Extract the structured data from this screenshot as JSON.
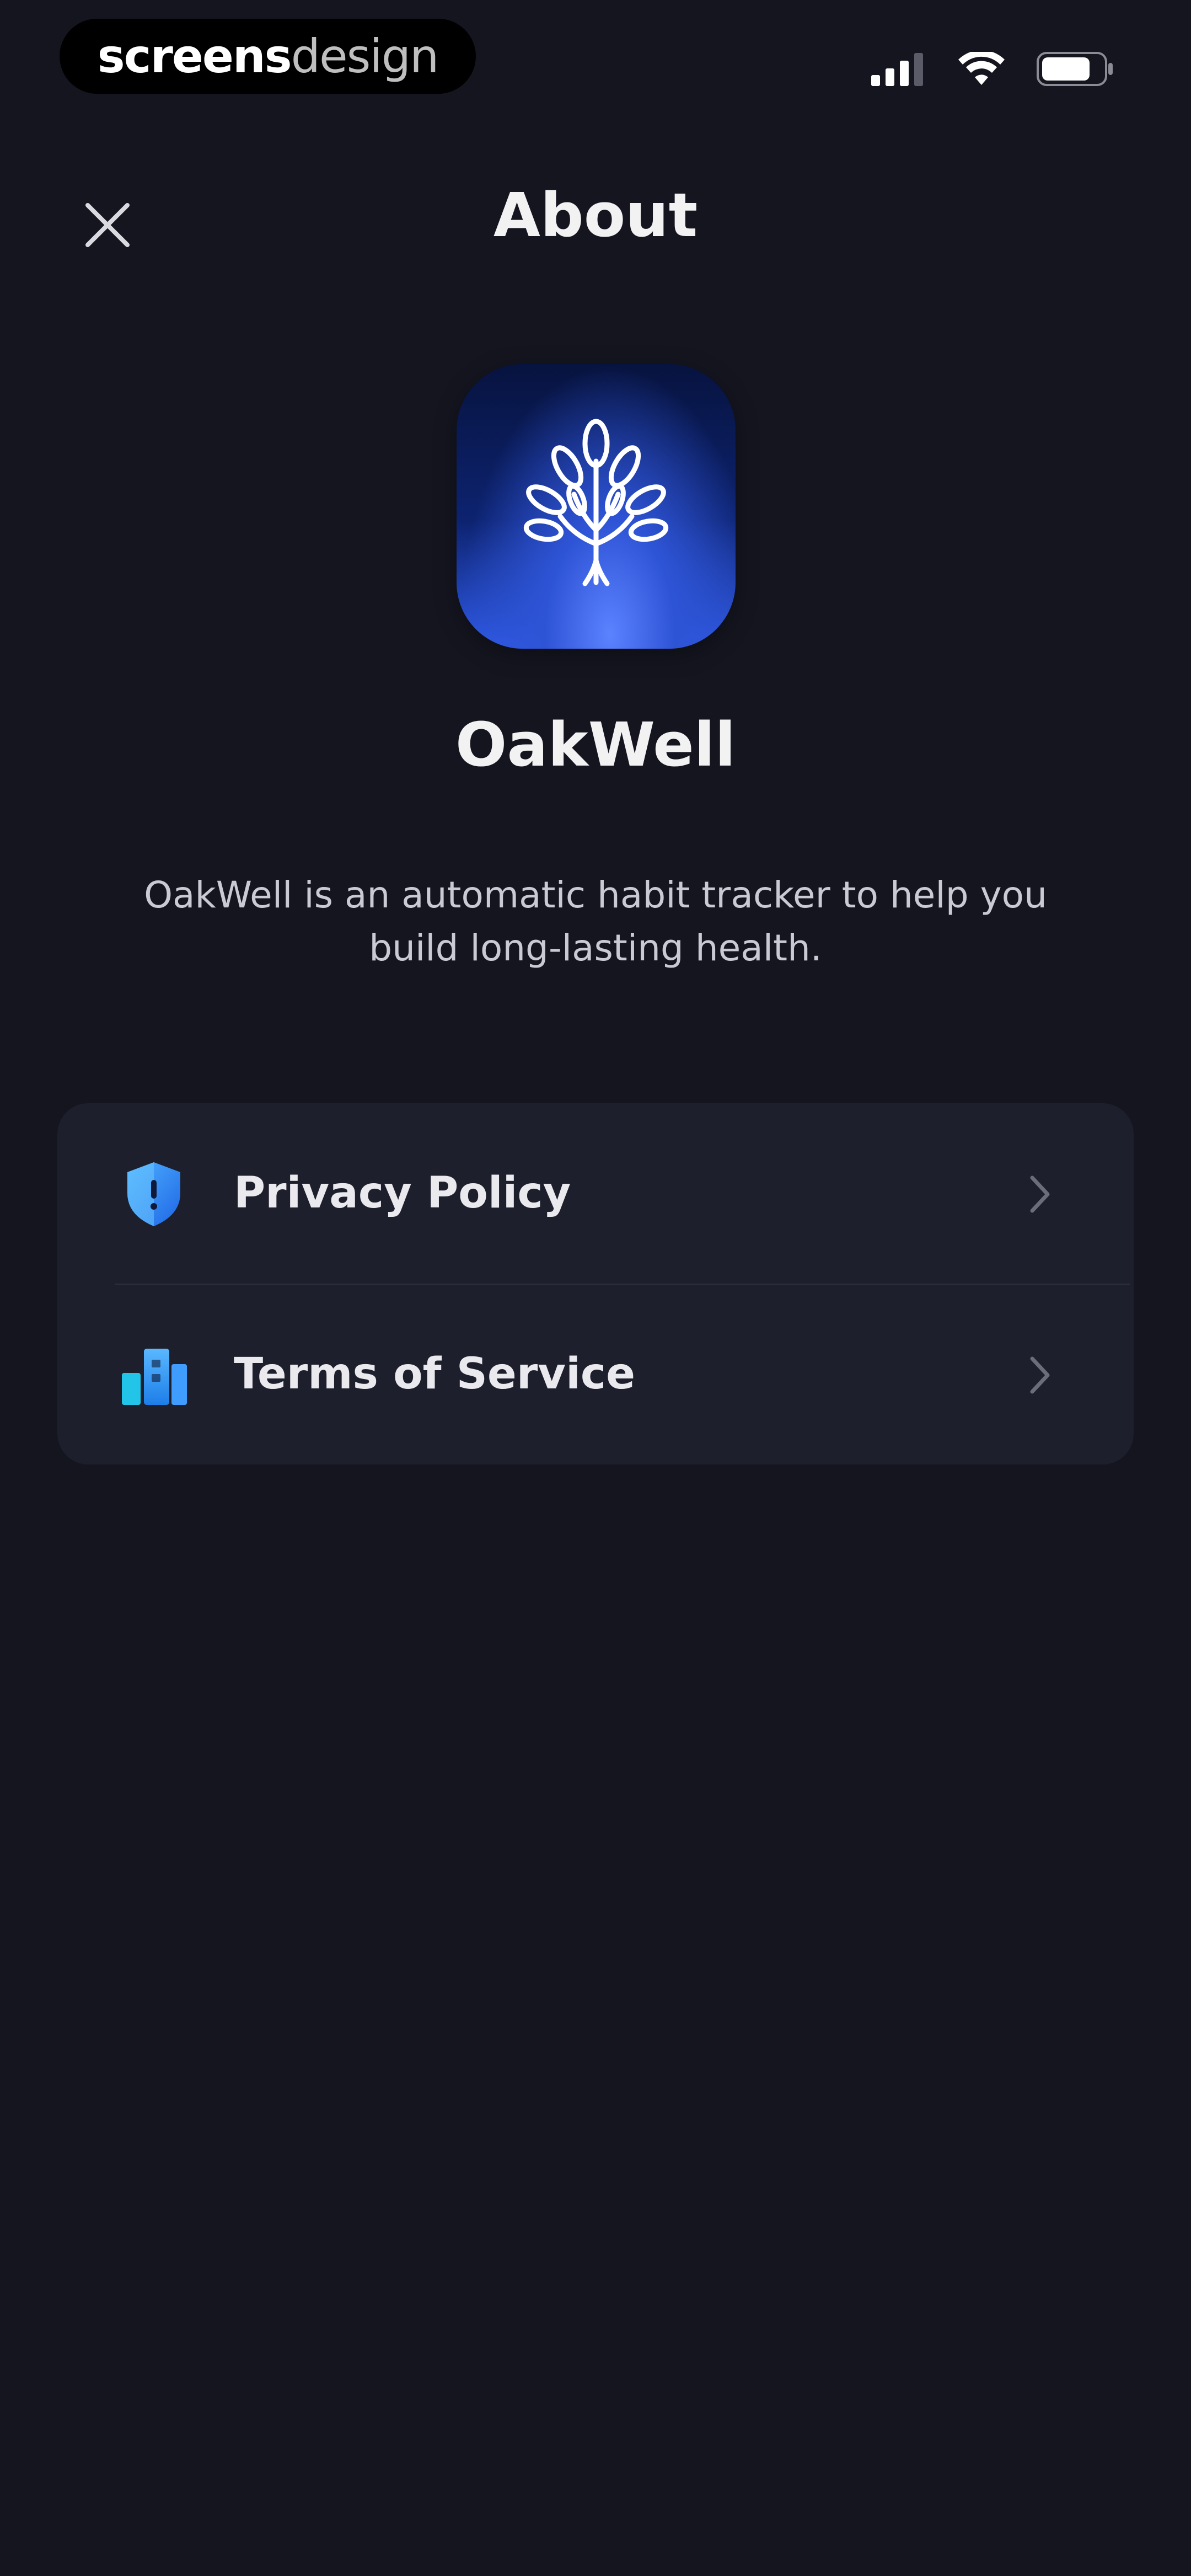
{
  "status_bar": {
    "watermark_bold": "screens",
    "watermark_light": "design"
  },
  "header": {
    "title": "About",
    "close_icon": "close-icon"
  },
  "app": {
    "name": "OakWell",
    "icon": "tree-icon",
    "description": "OakWell is an automatic habit tracker to help you build long-lasting health."
  },
  "links": [
    {
      "label": "Privacy Policy",
      "icon": "shield-icon",
      "accent": "#3a9bff"
    },
    {
      "label": "Terms of Service",
      "icon": "buildings-icon",
      "accent": "#27b4ff"
    }
  ],
  "colors": {
    "background": "#14151f",
    "card": "#1d1f2c",
    "divider": "#2b2d3b",
    "icon_gradient_top": "#07133f",
    "icon_gradient_bottom": "#2f5ae8"
  }
}
